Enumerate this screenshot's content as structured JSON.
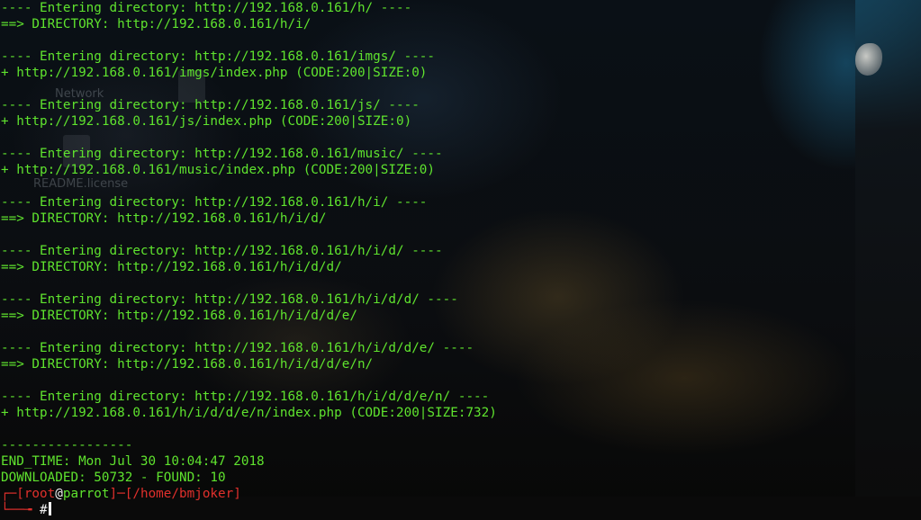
{
  "desktop": {
    "icons": [
      {
        "label": "Network",
        "icon": "network-folder-icon"
      },
      {
        "label": "README.license",
        "icon": "text-file-icon"
      }
    ]
  },
  "terminal": {
    "lines": [
      "---- Entering directory: http://192.168.0.161/h/ ----",
      "==> DIRECTORY: http://192.168.0.161/h/i/",
      "",
      "---- Entering directory: http://192.168.0.161/imgs/ ----",
      "+ http://192.168.0.161/imgs/index.php (CODE:200|SIZE:0)",
      "",
      "---- Entering directory: http://192.168.0.161/js/ ----",
      "+ http://192.168.0.161/js/index.php (CODE:200|SIZE:0)",
      "",
      "---- Entering directory: http://192.168.0.161/music/ ----",
      "+ http://192.168.0.161/music/index.php (CODE:200|SIZE:0)",
      "",
      "---- Entering directory: http://192.168.0.161/h/i/ ----",
      "==> DIRECTORY: http://192.168.0.161/h/i/d/",
      "",
      "---- Entering directory: http://192.168.0.161/h/i/d/ ----",
      "==> DIRECTORY: http://192.168.0.161/h/i/d/d/",
      "",
      "---- Entering directory: http://192.168.0.161/h/i/d/d/ ----",
      "==> DIRECTORY: http://192.168.0.161/h/i/d/d/e/",
      "",
      "---- Entering directory: http://192.168.0.161/h/i/d/d/e/ ----",
      "==> DIRECTORY: http://192.168.0.161/h/i/d/d/e/n/",
      "",
      "---- Entering directory: http://192.168.0.161/h/i/d/d/e/n/ ----",
      "+ http://192.168.0.161/h/i/d/d/e/n/index.php (CODE:200|SIZE:732)",
      "",
      "-----------------",
      "END_TIME: Mon Jul 30 10:04:47 2018",
      "DOWNLOADED: 50732 - FOUND: 10"
    ],
    "prompt": {
      "corner": "┌─[",
      "user": "root",
      "at": "@",
      "host": "parrot",
      "sep": "]─[",
      "path": "/home/bmjoker",
      "close": "]",
      "corner2": "└──╼ ",
      "symbol": "#"
    },
    "colors": {
      "text": "#5fe32e",
      "prompt_bracket": "#e0302c",
      "prompt_white": "#f2f2f2",
      "background": "#06080b"
    }
  }
}
